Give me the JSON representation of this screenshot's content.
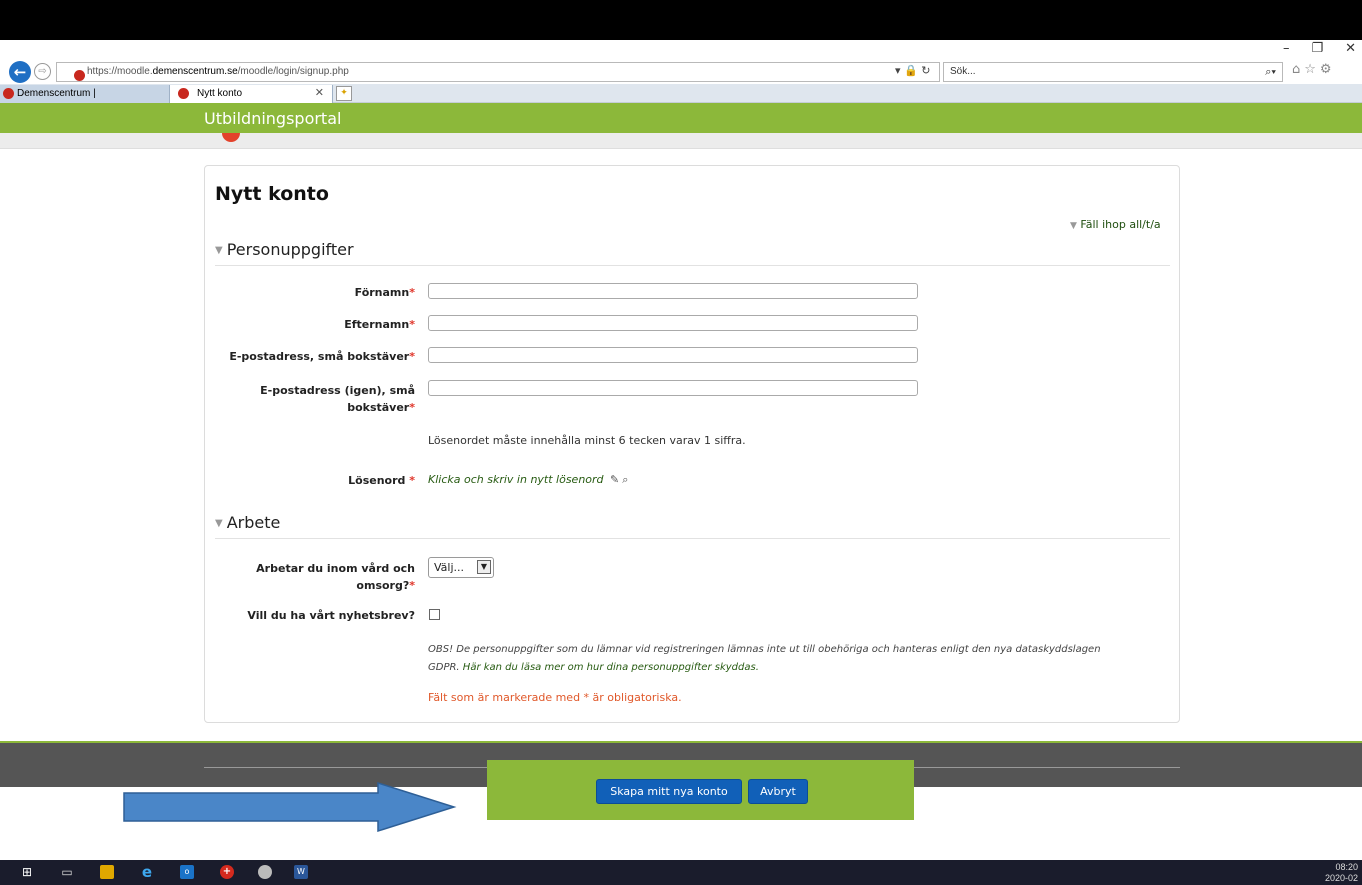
{
  "browser": {
    "url_prefix": "https://moodle.",
    "url_domain": "demenscentrum.se",
    "url_path": "/moodle/login/signup.php",
    "search_placeholder": "Sök...",
    "tabs": [
      {
        "label": "Demenscentrum |"
      },
      {
        "label": "Nytt konto"
      }
    ]
  },
  "header": {
    "portal_title": "Utbildningsportal"
  },
  "form": {
    "title": "Nytt konto",
    "collapse_all": "Fäll ihop all/t/a",
    "sections": [
      {
        "title": "Personuppgifter"
      },
      {
        "title": "Arbete"
      }
    ],
    "fields": {
      "firstname": {
        "label": "Förnamn",
        "value": ""
      },
      "lastname": {
        "label": "Efternamn",
        "value": ""
      },
      "email": {
        "label": "E-postadress, små bokstäver",
        "value": ""
      },
      "email2_line1": "E-postadress (igen), små",
      "email2_line2": "bokstäver",
      "email2_value": "",
      "password_hint": "Lösenordet måste innehålla minst 6 tecken varav 1 siffra.",
      "password_label": "Lösenord",
      "password_link": "Klicka och skriv in nytt lösenord",
      "work_line1": "Arbetar du inom vård och",
      "work_line2": "omsorg?",
      "work_selected": "Välj...",
      "newsletter_label": "Vill du ha vårt nyhetsbrev?",
      "newsletter_checked": false
    },
    "obs_text_line1": "OBS! De personuppgifter som du lämnar vid registreringen lämnas inte ut till obehöriga och hanteras enligt den nya dataskyddslagen",
    "obs_text_line2a": "GDPR. ",
    "obs_text_link": "Här kan du läsa mer om hur dina personuppgifter skyddas.",
    "required_marker": "*",
    "mandatory_note": "Fält som är markerade med * är obligatoriska."
  },
  "actions": {
    "create_label": "Skapa mitt nya konto",
    "cancel_label": "Avbryt"
  },
  "taskbar": {
    "time": "08:20",
    "date": "2020-02"
  },
  "colors": {
    "brand_green": "#8cb83a",
    "button_blue": "#1160b8",
    "required_red": "#e0352a",
    "arrow_blue": "#4a86c8"
  }
}
